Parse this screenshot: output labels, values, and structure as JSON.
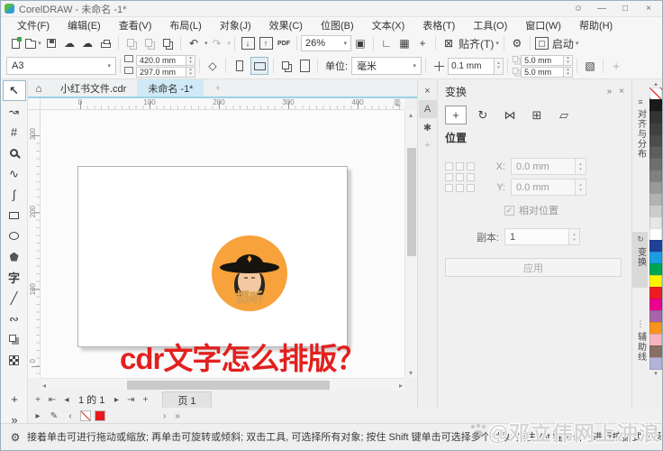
{
  "window": {
    "title": "CorelDRAW - 未命名 -1*"
  },
  "menu": {
    "items": [
      "文件(F)",
      "编辑(E)",
      "查看(V)",
      "布局(L)",
      "对象(J)",
      "效果(C)",
      "位图(B)",
      "文本(X)",
      "表格(T)",
      "工具(O)",
      "窗口(W)",
      "帮助(H)"
    ]
  },
  "toolbar": {
    "zoom_value": "26%",
    "pdf_label": "PDF",
    "snap_label": "贴齐(T)",
    "launch_label": "启动"
  },
  "propbar": {
    "page_size": "A3",
    "page_width": "420.0 mm",
    "page_height": "297.0 mm",
    "units_label": "单位:",
    "units_value": "毫米",
    "nudge_value": "0.1 mm",
    "dup_x": "5.0 mm",
    "dup_y": "5.0 mm"
  },
  "doc_tabs": {
    "tab1": "小红书文件.cdr",
    "tab2": "未命名 -1*"
  },
  "rulers": {
    "h_ticks": [
      "0",
      "100",
      "200",
      "300",
      "400"
    ],
    "h_unit": "毫米",
    "v_ticks": [
      "300",
      "200",
      "100",
      "0"
    ]
  },
  "canvas": {
    "logo_text": "探听",
    "headline": "cdr文字怎么排版？"
  },
  "docker": {
    "title": "变换",
    "position_heading": "位置",
    "x_label": "X:",
    "x_value": "0.0 mm",
    "y_label": "Y:",
    "y_value": "0.0 mm",
    "relative_label": "相对位置",
    "copies_label": "副本:",
    "copies_value": "1",
    "apply_label": "应用",
    "side_tabs": [
      "对齐与分布",
      "变换",
      "辅助线"
    ]
  },
  "page_bar": {
    "page_info": "1 的 1",
    "page_tab": "页 1"
  },
  "status_bar": {
    "hint": "接着单击可进行拖动或缩放; 再单击可旋转或倾斜; 双击工具, 可选择所有对象; 按住 Shift 键单击可选择多个对象; 按住 Alt 键单击可进行挖掘式选择",
    "watermark": "@邓立伟网上冲浪"
  },
  "palette": {
    "colors": [
      "#1a1a1a",
      "#333333",
      "#404040",
      "#4d4d4d",
      "#5e5e5e",
      "#6f6f6f",
      "#808080",
      "#9a9a9a",
      "#b3b3b3",
      "#cccccc",
      "#e6e6e6",
      "#ffffff",
      "#20409a",
      "#1b9de2",
      "#00a651",
      "#fff200",
      "#ed1c24",
      "#ec008c",
      "#a864a8",
      "#f7941d",
      "#f8b3c0",
      "#8a6e62",
      "#b3b3d9"
    ]
  },
  "theme": {
    "accent_blue": "#9ad2e8",
    "headline_red": "#e2201e",
    "logo_orange": "#f7a23b",
    "doc_red": "#e8191c"
  },
  "icons": {
    "account": "☺",
    "minimize": "—",
    "maximize": "□",
    "close": "×",
    "cloud": "☁",
    "undo": "↶",
    "redo": "↷",
    "import_arrow": "↓",
    "export_arrow": "↑",
    "fullscreen": "▣",
    "ruler": "∟",
    "grid": "▦",
    "guides": "+",
    "snap_off": "⊠",
    "gear": "⚙",
    "launch_win": "▢",
    "dropdown": "▾",
    "home": "⌂",
    "new_tab": "+",
    "pick": "↖",
    "shape": "↝",
    "crop": "#",
    "freehand": "∿",
    "artistic": "∫",
    "text_tool": "字",
    "dimension": "╱",
    "connector": "∾",
    "plus": "+",
    "chevrons": "»",
    "tr_rot": "↻",
    "tr_scale": "⋈",
    "tr_size": "⊞",
    "tr_skew": "▱",
    "strip_text": "A",
    "strip_star": "✱",
    "prev_end": "⇤",
    "prev": "◂",
    "next": "▸",
    "next_end": "⇥",
    "left": "‹",
    "right": "›",
    "eyedrop": "✎",
    "up": "▴",
    "down": "▾",
    "diamond": "◇",
    "fillstyle": "▧",
    "check": "✓"
  }
}
